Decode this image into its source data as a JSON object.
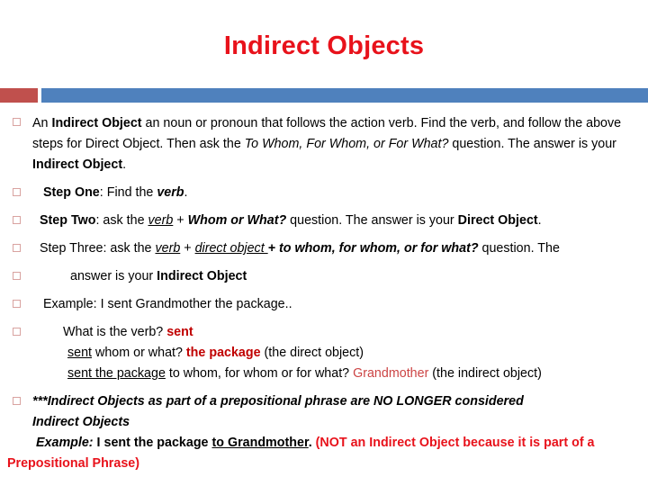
{
  "slide": {
    "title": "Indirect Objects",
    "title_color": "#E8121B",
    "accent_red": "#C0504D",
    "accent_blue": "#4F81BD",
    "bullet_color": "#D9A3A0"
  },
  "bullets": [
    {
      "id": "definition",
      "marker": "hollow-square",
      "text_plain": "An Indirect Object an noun or pronoun that follows the action verb. Find the verb, and follow the above steps for Direct Object. Then ask the To Whom, For Whom, or For What? question. The answer is your Indirect Object.",
      "segments": [
        {
          "t": "An ",
          "style": "normal"
        },
        {
          "t": "Indirect Object",
          "style": "bold"
        },
        {
          "t": " an noun or pronoun that follows the action verb. Find the verb, and follow the above steps for Direct Object. Then ask the ",
          "style": "normal"
        },
        {
          "t": "To Whom, For Whom, or For What?",
          "style": "italic"
        },
        {
          "t": " question. The answer is your ",
          "style": "normal"
        },
        {
          "t": "Indirect Object",
          "style": "bold"
        },
        {
          "t": ".",
          "style": "normal"
        }
      ]
    },
    {
      "id": "step-one",
      "marker": "hollow-square",
      "text_plain": "Step One: Find the verb.",
      "segments": [
        {
          "t": "Step One",
          "style": "bold"
        },
        {
          "t": ": Find the ",
          "style": "normal"
        },
        {
          "t": "verb",
          "style": "bold-italic"
        },
        {
          "t": ".",
          "style": "normal"
        }
      ]
    },
    {
      "id": "step-two",
      "marker": "hollow-square",
      "text_plain": "Step Two: ask the verb + Whom or What? question. The answer is your Direct Object.",
      "segments": [
        {
          "t": "Step Two",
          "style": "bold"
        },
        {
          "t": ": ask the ",
          "style": "normal"
        },
        {
          "t": "verb",
          "style": "underline-italic"
        },
        {
          "t": " + ",
          "style": "normal"
        },
        {
          "t": "Whom or What?",
          "style": "bold-italic"
        },
        {
          "t": " question. The answer is your ",
          "style": "normal"
        },
        {
          "t": "Direct Object",
          "style": "bold"
        },
        {
          "t": ".",
          "style": "normal"
        }
      ]
    },
    {
      "id": "step-three",
      "marker": "hollow-square",
      "text_plain": "Step Three: ask the verb + direct object + to whom, for whom, or for what? question. The",
      "segments": [
        {
          "t": "Step Three: ask the ",
          "style": "normal"
        },
        {
          "t": "verb",
          "style": "underline-italic"
        },
        {
          "t": " + ",
          "style": "normal"
        },
        {
          "t": "direct object ",
          "style": "underline-italic"
        },
        {
          "t": "+ to whom, for whom, or for what?",
          "style": "bold-italic"
        },
        {
          "t": " question. The",
          "style": "normal"
        }
      ]
    },
    {
      "id": "step-three-cont",
      "marker": "hollow-square",
      "text_plain": "answer is your Indirect Object",
      "segments": [
        {
          "t": "answer is your ",
          "style": "normal"
        },
        {
          "t": "Indirect Object",
          "style": "bold"
        }
      ]
    },
    {
      "id": "example",
      "marker": "hollow-square",
      "text_plain": "Example: I sent Grandmother the package..",
      "segments": [
        {
          "t": "Example: I sent Grandmother the package..",
          "style": "normal"
        }
      ]
    },
    {
      "id": "verb-question",
      "marker": "hollow-square",
      "text_plain": "What is the verb? sent",
      "segments": [
        {
          "t": "What is the verb? ",
          "style": "normal"
        },
        {
          "t": "sent",
          "style": "red-bold"
        }
      ]
    },
    {
      "id": "direct-object-line",
      "marker": "none",
      "text_plain": "sent whom or what? the package (the direct object)",
      "segments": [
        {
          "t": "sent",
          "style": "underline"
        },
        {
          "t": " whom or what? ",
          "style": "normal"
        },
        {
          "t": "the package",
          "style": "red-bold"
        },
        {
          "t": " (the direct object)",
          "style": "normal"
        }
      ]
    },
    {
      "id": "indirect-object-line",
      "marker": "none",
      "text_plain": "sent the package to whom, for whom or for what? Grandmother (the indirect object)",
      "segments": [
        {
          "t": "sent the package",
          "style": "underline"
        },
        {
          "t": " to whom, for whom or for what? ",
          "style": "normal"
        },
        {
          "t": "Grandmother",
          "style": "pink-red"
        },
        {
          "t": " (the indirect object)",
          "style": "normal"
        }
      ]
    },
    {
      "id": "prepositional-note",
      "marker": "hollow-square",
      "text_plain": "***Indirect Objects as part of a prepositional phrase are NO LONGER considered Indirect Objects",
      "segments": [
        {
          "t": "***Indirect Objects as part of a prepositional phrase are NO LONGER considered Indirect Objects",
          "style": "bold-italic"
        }
      ]
    },
    {
      "id": "prepositional-example",
      "marker": "none",
      "text_plain": "Example: I sent the package to Grandmother. (NOT an Indirect Object because it is part of a Prepositional Phrase)",
      "segments": [
        {
          "t": "Example:",
          "style": "bold-italic"
        },
        {
          "t": " I sent the package ",
          "style": "bold"
        },
        {
          "t": "to Grandmother",
          "style": "bold-underline"
        },
        {
          "t": ". ",
          "style": "bold"
        },
        {
          "t": "(NOT an Indirect Object because it is part of a Prepositional Phrase)",
          "style": "bright-red-bold"
        }
      ]
    }
  ]
}
